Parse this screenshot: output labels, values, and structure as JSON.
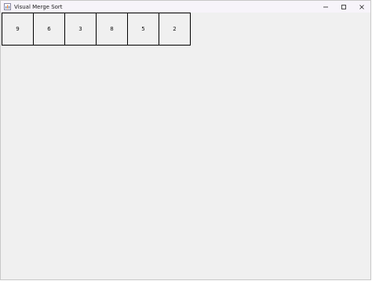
{
  "window": {
    "title": "Visual Merge Sort",
    "background": "#f0f0f0",
    "controls": {
      "minimize_icon": "minimize-icon",
      "maximize_icon": "maximize-icon",
      "close_icon": "close-icon"
    }
  },
  "array": {
    "cells": [
      "9",
      "6",
      "3",
      "8",
      "5",
      "2"
    ],
    "border_color": "#000000"
  }
}
